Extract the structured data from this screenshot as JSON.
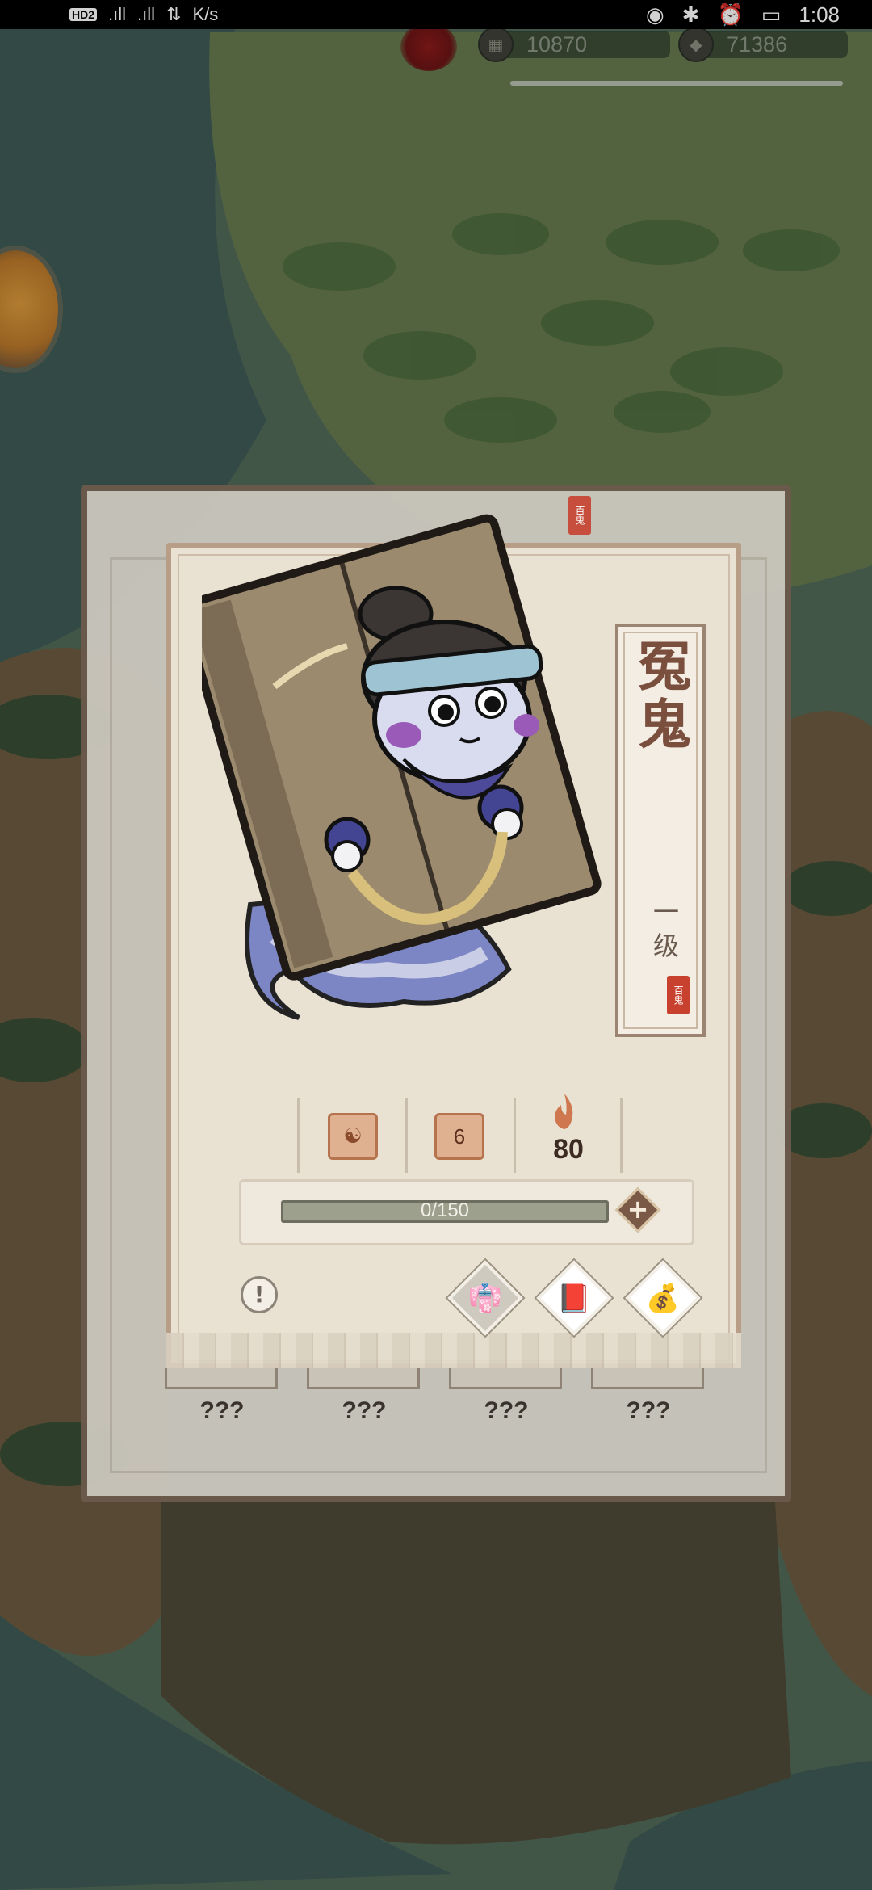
{
  "status_bar": {
    "left": {
      "hd": "HD",
      "sim": "2",
      "signal1": ".ıll",
      "signal2": ".ıll",
      "speed": "K/s"
    },
    "right": {
      "time": "1:08"
    }
  },
  "resources": {
    "gold": {
      "icon": "coin-stack-icon",
      "value": "10870"
    },
    "stone": {
      "icon": "stone-icon",
      "value": "71386"
    }
  },
  "card": {
    "name": "冤鬼",
    "level": "一级",
    "seal": "百鬼",
    "stats": {
      "stat1_icon": "yin-yang-icon",
      "stat2_value": "6",
      "fire_value": "80"
    },
    "progress": {
      "text": "0/150",
      "fraction": 0.0
    },
    "plus": "+",
    "info": "!",
    "actions": [
      {
        "name": "clothes",
        "icon": "robe-icon",
        "glyph": "👘"
      },
      {
        "name": "book",
        "icon": "book-icon",
        "glyph": "📕"
      },
      {
        "name": "bag",
        "icon": "money-bag-icon",
        "glyph": "💰"
      }
    ]
  },
  "background_panel": {
    "unknown_entries": [
      "???",
      "???",
      "???",
      "???"
    ]
  },
  "colors": {
    "card_bg": "#e9e2d3",
    "name_color": "#7b4f3e",
    "seal_red": "#c8412f",
    "progress_track": "#9ea08e"
  }
}
